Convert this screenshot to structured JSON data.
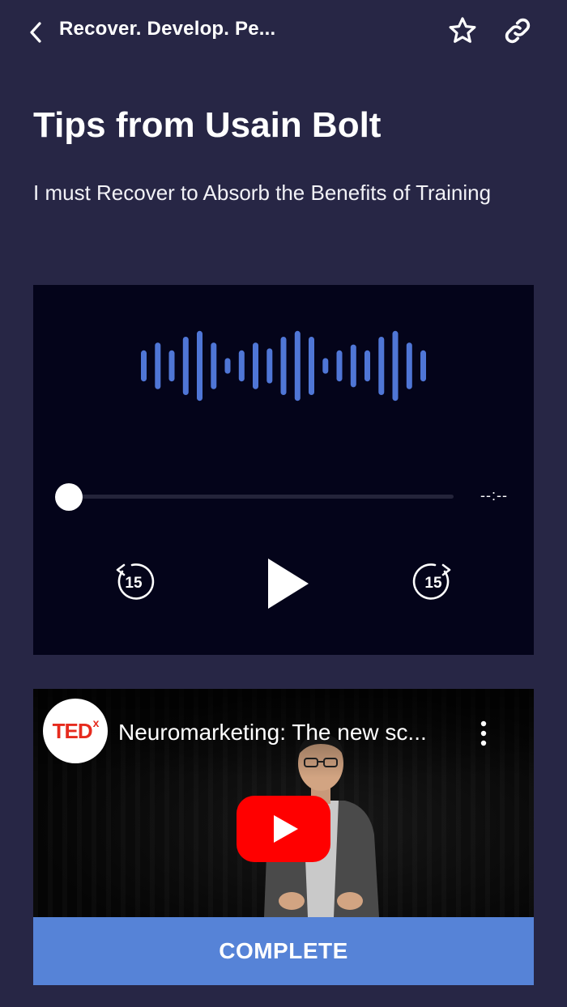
{
  "header": {
    "title": "Recover. Develop. Pe...",
    "back_icon": "chevron-left-icon",
    "star_icon": "star-outline-icon",
    "link_icon": "link-icon"
  },
  "content": {
    "title": "Tips from Usain Bolt",
    "subtitle": "I must Recover to Absorb the Benefits of Training"
  },
  "audio_player": {
    "time_remaining": "--:--",
    "progress": 0,
    "rewind_seconds": "15",
    "forward_seconds": "15",
    "waveform_color": "#4f76d6",
    "waveform_levels": [
      0.4,
      0.6,
      0.4,
      0.75,
      0.9,
      0.6,
      0.2,
      0.4,
      0.6,
      0.45,
      0.75,
      0.9,
      0.75,
      0.2,
      0.4,
      0.55,
      0.4,
      0.75,
      0.9,
      0.6,
      0.4
    ]
  },
  "video": {
    "channel_logo_text": "TED",
    "channel_logo_superscript": "x",
    "title": "Neuromarketing: The new sc...",
    "menu_icon": "more-vertical-icon",
    "play_icon": "youtube-play-icon"
  },
  "actions": {
    "complete_label": "COMPLETE"
  },
  "colors": {
    "background": "#272645",
    "card": "#04041a",
    "accent": "#5683d7",
    "youtube_red": "#ff0000"
  }
}
